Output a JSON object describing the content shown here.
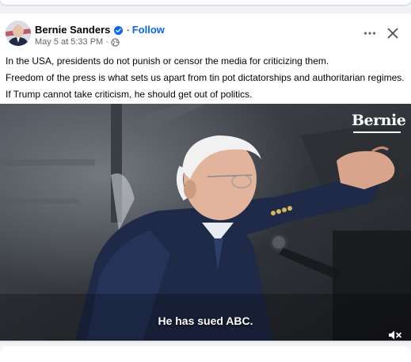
{
  "post": {
    "author": "Bernie Sanders",
    "follow_label": "Follow",
    "timestamp": "May 5 at 5:33 PM",
    "privacy_icon": "globe-icon",
    "body_lines": [
      "In the USA, presidents do not punish or censor the media for criticizing them.",
      "Freedom of the press is what sets us apart from tin pot dictatorships and authoritarian regimes.",
      "If Trump cannot take criticism, he should get out of politics."
    ]
  },
  "video": {
    "watermark": "Bernie",
    "caption": "He has sued ABC.",
    "mute_icon": "speaker-muted-icon"
  },
  "colors": {
    "link_blue": "#0866ff",
    "meta_gray": "#65676b",
    "text": "#050505"
  }
}
